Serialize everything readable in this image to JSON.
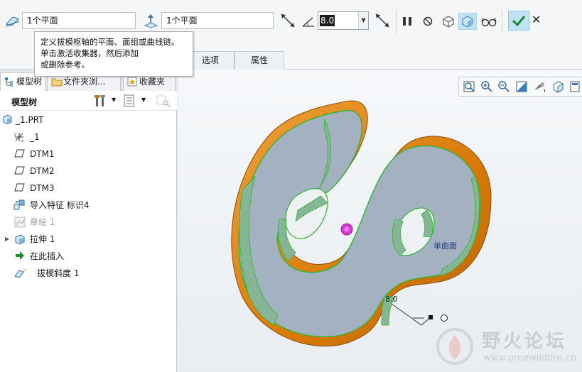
{
  "dashboard": {
    "reference_field_1": "1个平面",
    "reference_field_2": "1个平面",
    "angle_value": "8.0"
  },
  "tabs": [
    {
      "label": "选项"
    },
    {
      "label": "属性"
    }
  ],
  "tooltip": {
    "line1": "定义拔模枢轴的平面、面组或曲线链。",
    "line2": "单击激活收集器，然后添加",
    "line3": "或删除参考。"
  },
  "panel_tabs": [
    {
      "label": "模型树"
    },
    {
      "label": "文件夹浏..."
    },
    {
      "label": "收藏夹"
    }
  ],
  "tree": {
    "header_title": "模型树",
    "items": [
      {
        "label": "_1.PRT"
      },
      {
        "label": "_1"
      },
      {
        "label": "DTM1"
      },
      {
        "label": "DTM2"
      },
      {
        "label": "DTM3"
      },
      {
        "label": "导入特征 标识4"
      },
      {
        "label": "草绘 1"
      },
      {
        "label": "拉伸 1"
      },
      {
        "label": "在此插入"
      },
      {
        "label": "拔模斜度 1"
      }
    ]
  },
  "viewport": {
    "surface_label": "单曲面",
    "dimension_label": "8.0"
  },
  "watermark": {
    "title": "野火论坛",
    "url": "www.proewildfire.cn"
  },
  "colors": {
    "model_face": "#a3b1c1",
    "model_side": "#e8860a",
    "highlight_green": "#32c832",
    "ok_button": "#bfe3f5"
  }
}
